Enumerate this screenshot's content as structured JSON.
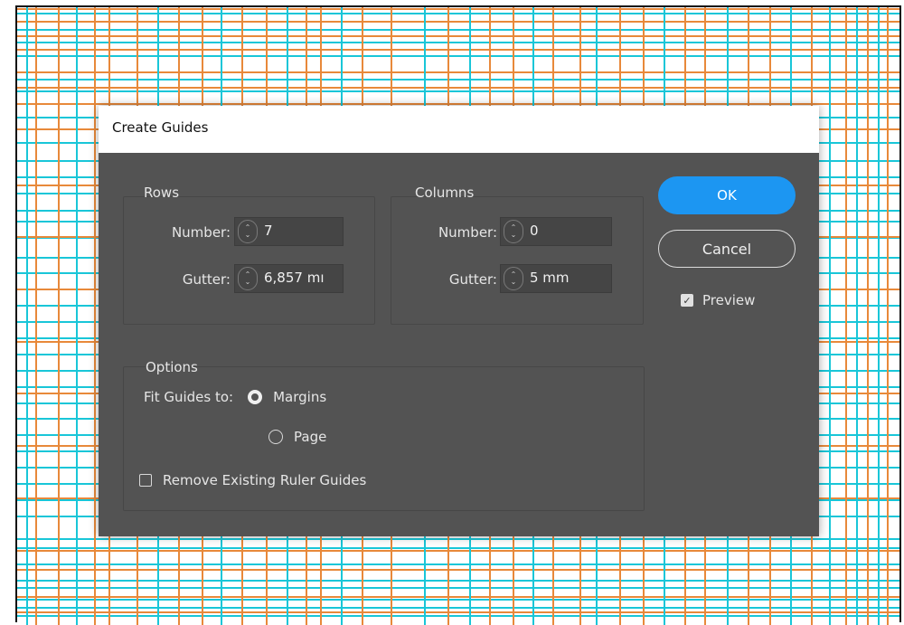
{
  "colors": {
    "background_guide_cyan": "#19c6d8",
    "background_guide_orange": "#e8893a",
    "dialog_bg": "#535353",
    "ok_button": "#1c96f2"
  },
  "dialog": {
    "title": "Create Guides",
    "rows": {
      "title": "Rows",
      "number_label": "Number:",
      "number_value": "7",
      "gutter_label": "Gutter:",
      "gutter_value": "6,857 mı"
    },
    "columns": {
      "title": "Columns",
      "number_label": "Number:",
      "number_value": "0",
      "gutter_label": "Gutter:",
      "gutter_value": "5 mm"
    },
    "buttons": {
      "ok": "OK",
      "cancel": "Cancel"
    },
    "preview": {
      "label": "Preview",
      "checked": true
    },
    "options": {
      "title": "Options",
      "fit_label": "Fit Guides to:",
      "margins_label": "Margins",
      "page_label": "Page",
      "selected": "Margins",
      "remove_label": "Remove Existing Ruler Guides",
      "remove_checked": false
    }
  }
}
